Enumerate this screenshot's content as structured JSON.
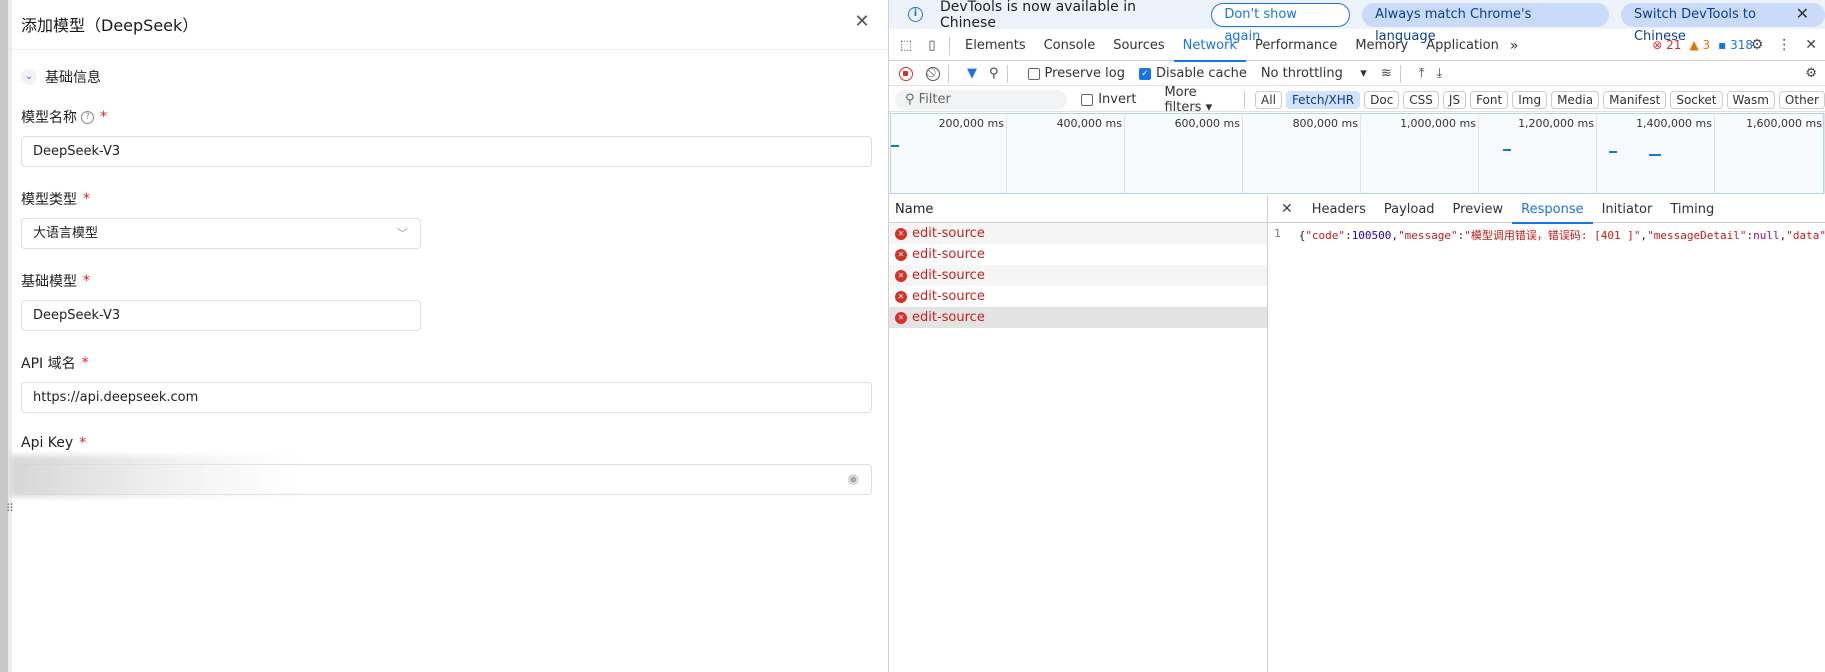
{
  "modal": {
    "title": "添加模型（DeepSeek）",
    "section_title": "基础信息",
    "fields": {
      "model_name": {
        "label": "模型名称",
        "value": "DeepSeek-V3"
      },
      "model_type": {
        "label": "模型类型",
        "value": "大语言模型"
      },
      "base_model": {
        "label": "基础模型",
        "value": "DeepSeek-V3"
      },
      "api_domain": {
        "label": "API 域名",
        "value": "https://api.deepseek.com"
      },
      "api_key": {
        "label": "Api Key",
        "value": ""
      }
    },
    "required_mark": "*",
    "help_glyph": "?"
  },
  "devtools": {
    "infobar": {
      "message": "DevTools is now available in Chinese",
      "dont_show": "Don't show again",
      "always_match": "Always match Chrome's language",
      "switch": "Switch DevTools to Chinese"
    },
    "tabs": [
      "Elements",
      "Console",
      "Sources",
      "Network",
      "Performance",
      "Memory",
      "Application"
    ],
    "active_tab": "Network",
    "counts": {
      "errors": "21",
      "warnings": "3",
      "messages": "318"
    },
    "toolbar": {
      "preserve_log": "Preserve log",
      "disable_cache": "Disable cache",
      "throttling": "No throttling"
    },
    "filter": {
      "placeholder": "Filter",
      "invert": "Invert",
      "more_filters": "More filters",
      "types": [
        "All",
        "Fetch/XHR",
        "Doc",
        "CSS",
        "JS",
        "Font",
        "Img",
        "Media",
        "Manifest",
        "Socket",
        "Wasm",
        "Other"
      ],
      "active_type": "Fetch/XHR"
    },
    "timeline_ticks": [
      "200,000 ms",
      "400,000 ms",
      "600,000 ms",
      "800,000 ms",
      "1,000,000 ms",
      "1,200,000 ms",
      "1,400,000 ms",
      "1,600,000 ms"
    ],
    "requests": {
      "header": "Name",
      "rows": [
        "edit-source",
        "edit-source",
        "edit-source",
        "edit-source",
        "edit-source"
      ]
    },
    "detail_tabs": [
      "Headers",
      "Payload",
      "Preview",
      "Response",
      "Initiator",
      "Timing"
    ],
    "active_detail_tab": "Response",
    "response": {
      "line_number": "1",
      "parts": {
        "p1": "{",
        "k1": "\"code\"",
        "c1": ":",
        "v1": "100500",
        "c2": ",",
        "k2": "\"message\"",
        "c3": ":",
        "v2": "\"模型调用错误，错误码: [401 ]\"",
        "c4": ",",
        "k3": "\"messageDetail\"",
        "c5": ":",
        "v3": "null",
        "c6": ",",
        "k4": "\"data\""
      }
    }
  }
}
